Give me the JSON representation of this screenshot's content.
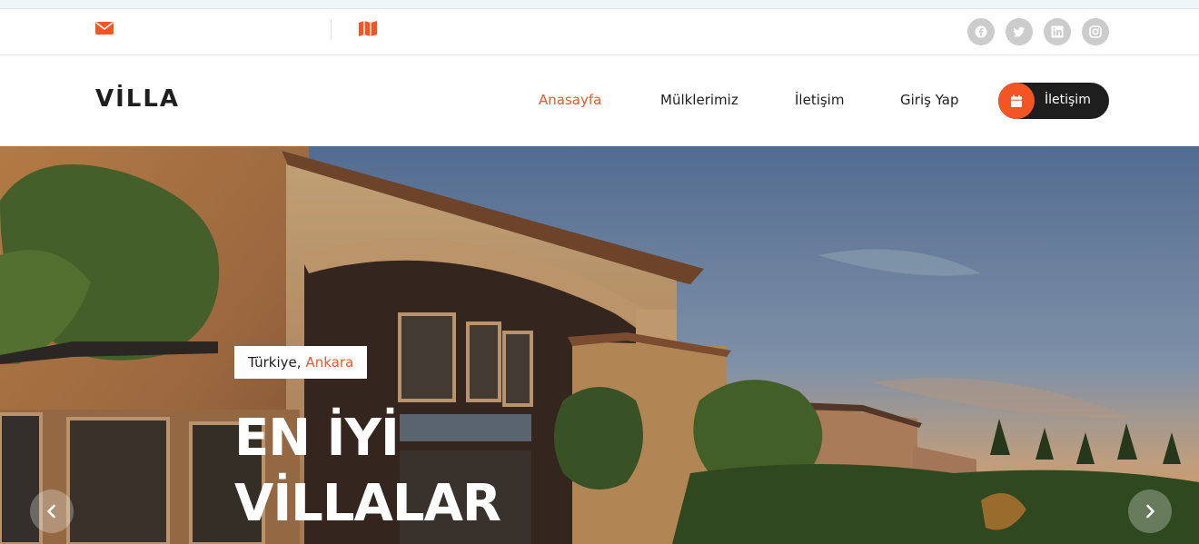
{
  "colors": {
    "accent": "#f35525",
    "dark": "#1e1e1e",
    "social_bg": "#cccccc"
  },
  "subheader": {
    "email_icon": "envelope-icon",
    "email_text": "",
    "map_icon": "map-icon",
    "address_text": "",
    "socials": [
      "facebook-icon",
      "twitter-icon",
      "linkedin-icon",
      "instagram-icon"
    ]
  },
  "brand": {
    "logo": "VİLLA"
  },
  "nav": {
    "items": [
      {
        "label": "Anasayfa",
        "active": true
      },
      {
        "label": "Mülklerimiz",
        "active": false
      },
      {
        "label": "İletişim",
        "active": false
      },
      {
        "label": "Giriş Yap",
        "active": false
      }
    ],
    "cta": {
      "label": "İletişim",
      "icon": "calendar-icon"
    }
  },
  "hero": {
    "location_country": "Türkiye,",
    "location_city": "Ankara",
    "title_line1": "EN İYİ",
    "title_line2": "VİLLALAR",
    "prev_icon": "chevron-left-icon",
    "next_icon": "chevron-right-icon"
  }
}
